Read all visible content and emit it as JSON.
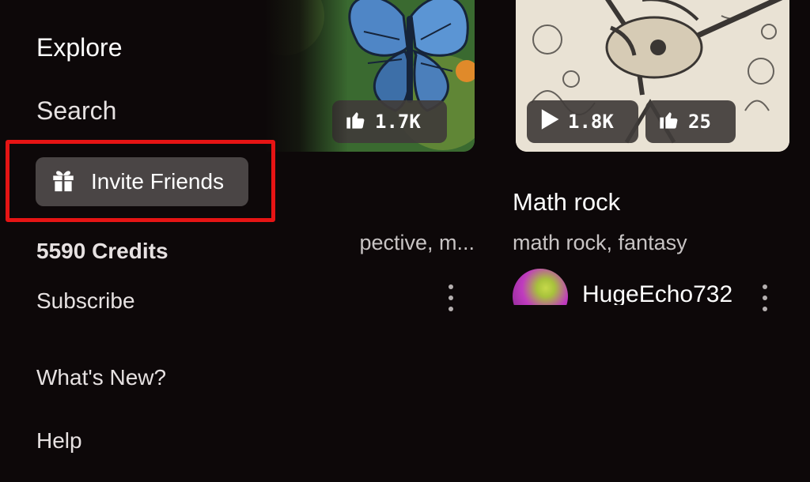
{
  "menu": {
    "explore": "Explore",
    "search": "Search",
    "invite_friends": "Invite Friends",
    "credits": "5590 Credits",
    "subscribe": "Subscribe",
    "whats_new": "What's New?",
    "help": "Help"
  },
  "feed": {
    "left_card": {
      "likes": "1.7K",
      "tags_visible": "pective, m..."
    },
    "right_card": {
      "plays": "1.8K",
      "likes": "25",
      "title": "Math rock",
      "tags": "math rock, fantasy",
      "username": "HugeEcho732"
    }
  },
  "colors": {
    "background": "#0d0809",
    "highlight_border": "#e61414",
    "invite_button_bg": "#4a4545",
    "stat_pill_bg": "#403c3a"
  },
  "icons": {
    "invite": "gift-icon",
    "play": "play-icon",
    "like": "thumbs-up-icon",
    "more": "kebab-menu-icon"
  }
}
